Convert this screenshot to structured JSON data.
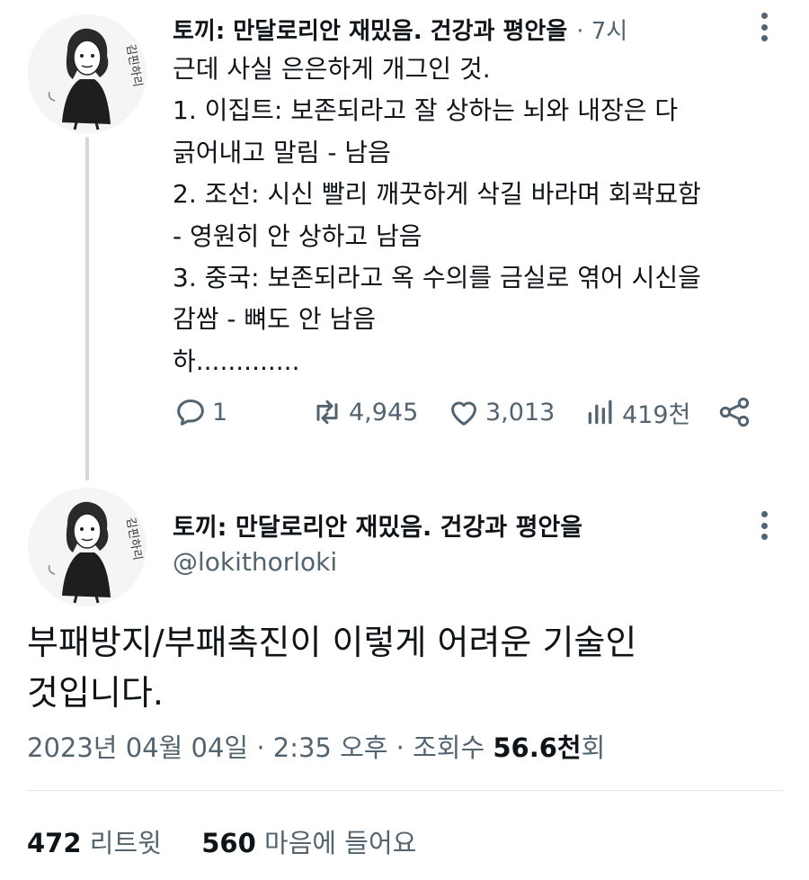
{
  "thread_tweet": {
    "author_name": "토끼: 만달로리안 재밌음. 건강과 평안을",
    "time": "· 7시",
    "body_lines": [
      "근데 사실 은은하게 개그인 것.",
      "1. 이집트: 보존되라고 잘 상하는 뇌와 내장은 다",
      "긁어내고 말림 - 남음",
      "2. 조선: 시신 빨리 깨끗하게 삭길 바라며 회곽묘함",
      "- 영원히 안 상하고 남음",
      "3. 중국: 보존되라고 옥 수의를 금실로 엮어 시신을",
      "감쌈 - 뼈도 안 남음",
      "하............."
    ],
    "actions": {
      "replies": "1",
      "retweets": "4,945",
      "likes": "3,013",
      "views": "419천"
    },
    "avatar_caption": "김핀하리"
  },
  "main_tweet": {
    "author_name": "토끼: 만달로리안 재밌음. 건강과 평안을",
    "handle": "@lokithorloki",
    "body_lines": [
      "부패방지/부패촉진이 이렇게 어려운 기술인",
      "것입니다."
    ],
    "date": "2023년 04월 04일",
    "time": "2:35 오후",
    "views_label": "조회수",
    "views_value": "56.6천",
    "views_suffix": "회",
    "retweet_count": "472",
    "retweet_label": "리트윗",
    "like_count": "560",
    "like_label": "마음에 들어요",
    "avatar_caption": "김핀하리"
  },
  "colors": {
    "text_primary": "#0f1419",
    "text_secondary": "#536471",
    "thread_line": "#cfd9de",
    "divider": "#e1e6ea"
  },
  "icons": [
    "more-vertical-icon",
    "reply-icon",
    "retweet-icon",
    "like-icon",
    "views-icon",
    "share-icon"
  ]
}
